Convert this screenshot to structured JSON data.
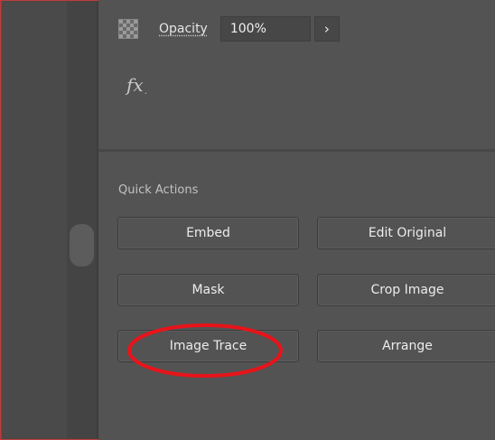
{
  "properties_panel": {
    "opacity": {
      "label": "Opacity",
      "value": "100%",
      "expand_icon": "›"
    },
    "effects_icon": "fx",
    "effects_icon_suffix": "."
  },
  "quick_actions": {
    "title": "Quick Actions",
    "buttons": [
      {
        "label": "Embed"
      },
      {
        "label": "Edit Original"
      },
      {
        "label": "Mask"
      },
      {
        "label": "Crop Image"
      },
      {
        "label": "Image Trace"
      },
      {
        "label": "Arrange"
      }
    ]
  },
  "annotation": {
    "highlight_color": "#e8141a",
    "highlighted_button": "Image Trace"
  },
  "colors": {
    "panel_bg": "#535353",
    "frame_border": "#c23b3b"
  }
}
